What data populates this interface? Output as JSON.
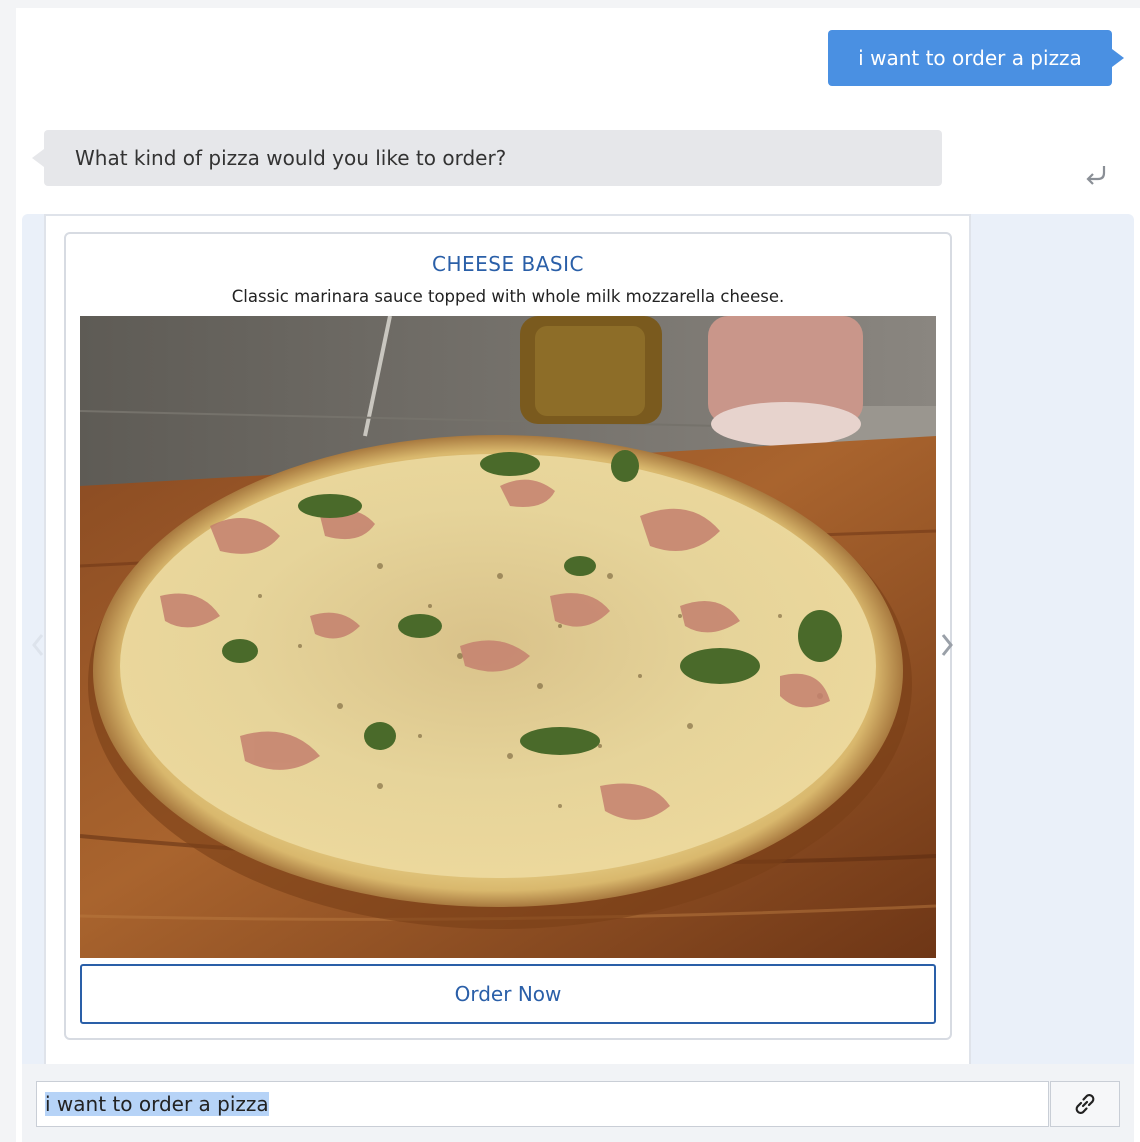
{
  "messages": {
    "user": "i want to order a pizza",
    "bot": "What kind of pizza would you like to order?"
  },
  "card": {
    "title": "CHEESE BASIC",
    "description": "Classic marinara sauce topped with whole milk mozzarella cheese.",
    "button_label": "Order Now",
    "image_subject": "pizza-photo"
  },
  "input": {
    "value": "i want to order a pizza"
  },
  "icons": {
    "replay": "replay-icon",
    "prev": "chevron-left-icon",
    "next": "chevron-right-icon",
    "attach": "link-icon"
  },
  "colors": {
    "user_bubble": "#4a90e2",
    "bot_bubble": "#e6e7ea",
    "accent": "#2a5fa8"
  }
}
